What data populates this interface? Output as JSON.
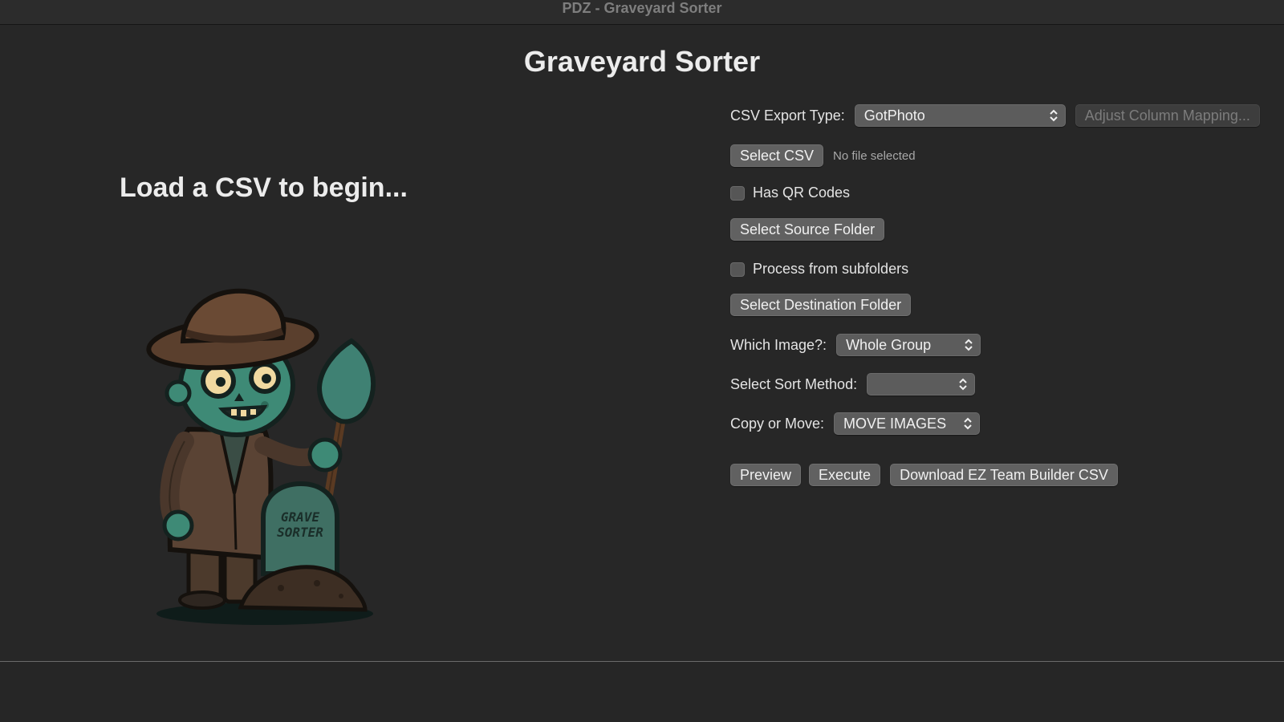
{
  "window": {
    "title": "PDZ - Graveyard Sorter"
  },
  "app": {
    "heading": "Graveyard Sorter",
    "prompt": "Load a CSV to begin..."
  },
  "mascot": {
    "icon": "zombie-gravedigger-illustration",
    "tombstone_text": "GRAVE SORTER"
  },
  "form": {
    "export_type_label": "CSV Export Type:",
    "export_type_value": "GotPhoto",
    "adjust_mapping_label": "Adjust Column Mapping...",
    "select_csv_label": "Select CSV",
    "csv_status": "No file selected",
    "has_qr_label": "Has QR Codes",
    "has_qr_checked": false,
    "select_source_label": "Select Source Folder",
    "subfolders_label": "Process from subfolders",
    "subfolders_checked": false,
    "select_dest_label": "Select Destination Folder",
    "which_image_label": "Which Image?:",
    "which_image_value": "Whole Group",
    "sort_method_label": "Select Sort Method:",
    "sort_method_value": "",
    "copy_move_label": "Copy or Move:",
    "copy_move_value": "MOVE IMAGES"
  },
  "actions": {
    "preview_label": "Preview",
    "execute_label": "Execute",
    "download_label": "Download EZ Team Builder CSV"
  },
  "colors": {
    "background": "#272727",
    "button": "#616161",
    "zombie_skin": "#3e8a76"
  }
}
